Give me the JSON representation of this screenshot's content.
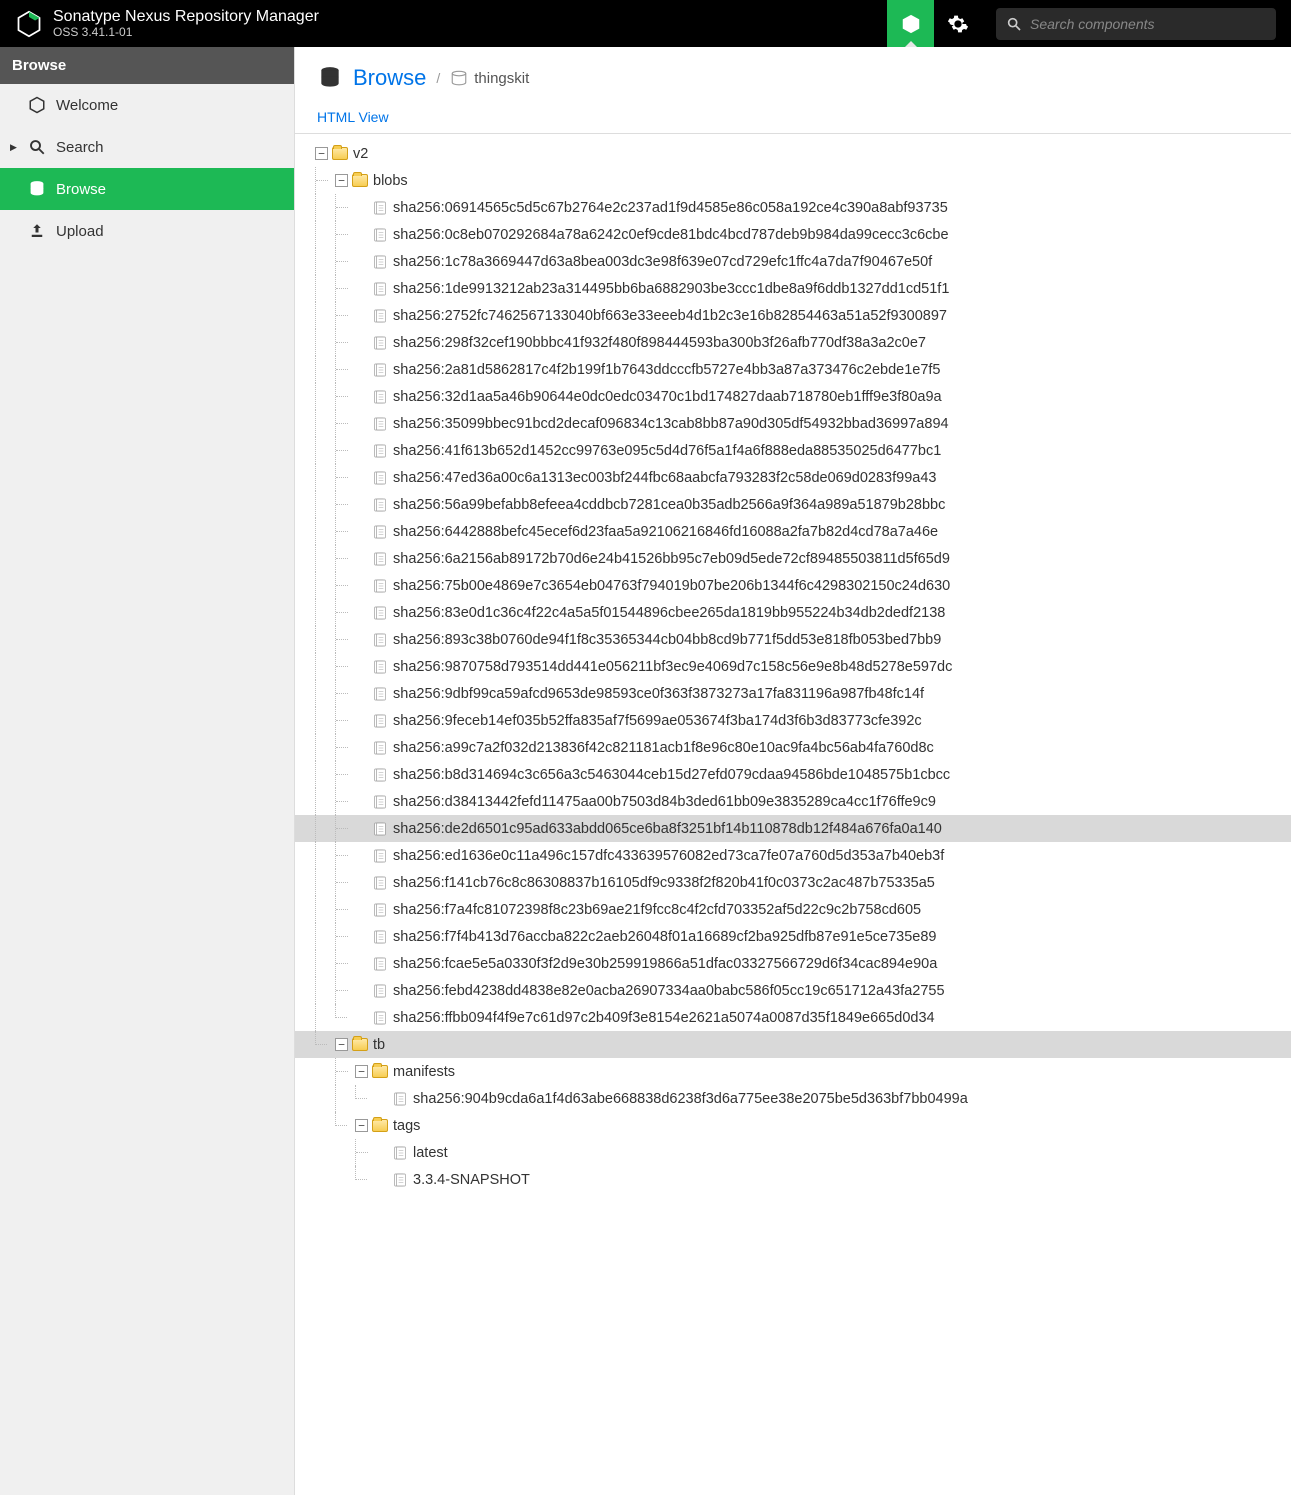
{
  "header": {
    "product_title": "Sonatype Nexus Repository Manager",
    "product_version": "OSS 3.41.1-01",
    "search_placeholder": "Search components"
  },
  "sidebar": {
    "title": "Browse",
    "items": [
      {
        "label": "Welcome",
        "icon": "hexagon-icon",
        "expandable": false,
        "active": false
      },
      {
        "label": "Search",
        "icon": "search-icon",
        "expandable": true,
        "active": false
      },
      {
        "label": "Browse",
        "icon": "database-icon",
        "expandable": false,
        "active": true
      },
      {
        "label": "Upload",
        "icon": "upload-icon",
        "expandable": false,
        "active": false
      }
    ]
  },
  "page": {
    "title": "Browse",
    "repo_name": "thingskit",
    "html_view_label": "HTML View"
  },
  "tree": {
    "v2_label": "v2",
    "blobs_label": "blobs",
    "blobs": [
      "sha256:06914565c5d5c67b2764e2c237ad1f9d4585e86c058a192ce4c390a8abf93735",
      "sha256:0c8eb070292684a78a6242c0ef9cde81bdc4bcd787deb9b984da99cecc3c6cbe",
      "sha256:1c78a3669447d63a8bea003dc3e98f639e07cd729efc1ffc4a7da7f90467e50f",
      "sha256:1de9913212ab23a314495bb6ba6882903be3ccc1dbe8a9f6ddb1327dd1cd51f1",
      "sha256:2752fc7462567133040bf663e33eeeb4d1b2c3e16b82854463a51a52f9300897",
      "sha256:298f32cef190bbbc41f932f480f898444593ba300b3f26afb770df38a3a2c0e7",
      "sha256:2a81d5862817c4f2b199f1b7643ddcccfb5727e4bb3a87a373476c2ebde1e7f5",
      "sha256:32d1aa5a46b90644e0dc0edc03470c1bd174827daab718780eb1fff9e3f80a9a",
      "sha256:35099bbec91bcd2decaf096834c13cab8bb87a90d305df54932bbad36997a894",
      "sha256:41f613b652d1452cc99763e095c5d4d76f5a1f4a6f888eda88535025d6477bc1",
      "sha256:47ed36a00c6a1313ec003bf244fbc68aabcfa793283f2c58de069d0283f99a43",
      "sha256:56a99befabb8efeea4cddbcb7281cea0b35adb2566a9f364a989a51879b28bbc",
      "sha256:6442888befc45ecef6d23faa5a92106216846fd16088a2fa7b82d4cd78a7a46e",
      "sha256:6a2156ab89172b70d6e24b41526bb95c7eb09d5ede72cf89485503811d5f65d9",
      "sha256:75b00e4869e7c3654eb04763f794019b07be206b1344f6c4298302150c24d630",
      "sha256:83e0d1c36c4f22c4a5a5f01544896cbee265da1819bb955224b34db2dedf2138",
      "sha256:893c38b0760de94f1f8c35365344cb04bb8cd9b771f5dd53e818fb053bed7bb9",
      "sha256:9870758d793514dd441e056211bf3ec9e4069d7c158c56e9e8b48d5278e597dc",
      "sha256:9dbf99ca59afcd9653de98593ce0f363f3873273a17fa831196a987fb48fc14f",
      "sha256:9feceb14ef035b52ffa835af7f5699ae053674f3ba174d3f6b3d83773cfe392c",
      "sha256:a99c7a2f032d213836f42c821181acb1f8e96c80e10ac9fa4bc56ab4fa760d8c",
      "sha256:b8d314694c3c656a3c5463044ceb15d27efd079cdaa94586bde1048575b1cbcc",
      "sha256:d38413442fefd11475aa00b7503d84b3ded61bb09e3835289ca4cc1f76ffe9c9",
      "sha256:de2d6501c95ad633abdd065ce6ba8f3251bf14b110878db12f484a676fa0a140",
      "sha256:ed1636e0c11a496c157dfc433639576082ed73ca7fe07a760d5d353a7b40eb3f",
      "sha256:f141cb76c8c86308837b16105df9c9338f2f820b41f0c0373c2ac487b75335a5",
      "sha256:f7a4fc81072398f8c23b69ae21f9fcc8c4f2cfd703352af5d22c9c2b758cd605",
      "sha256:f7f4b413d76accba822c2aeb26048f01a16689cf2ba925dfb87e91e5ce735e89",
      "sha256:fcae5e5a0330f3f2d9e30b259919866a51dfac03327566729d6f34cac894e90a",
      "sha256:febd4238dd4838e82e0acba26907334aa0babc586f05cc19c651712a43fa2755",
      "sha256:ffbb094f4f9e7c61d97c2b409f3e8154e2621a5074a0087d35f1849e665d0d34"
    ],
    "selected_blob_index": 23,
    "tb_label": "tb",
    "manifests_label": "manifests",
    "manifests": [
      "sha256:904b9cda6a1f4d63abe668838d6238f3d6a775ee38e2075be5d363bf7bb0499a"
    ],
    "tags_label": "tags",
    "tags": [
      "latest",
      "3.3.4-SNAPSHOT"
    ]
  }
}
